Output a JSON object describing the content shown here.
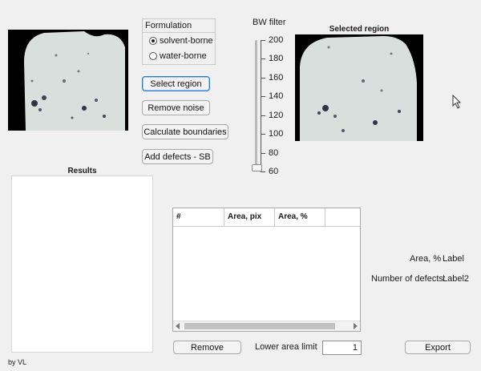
{
  "formulation": {
    "title": "Formulation",
    "options": [
      {
        "label": "solvent-borne",
        "selected": true
      },
      {
        "label": "water-borne",
        "selected": false
      }
    ]
  },
  "buttons": {
    "select_region": "Select region",
    "remove_noise": "Remove noise",
    "calculate_boundaries": "Calculate boundaries",
    "add_defects": "Add defects - SB",
    "remove": "Remove",
    "export": "Export"
  },
  "bw_filter": {
    "label": "BW filter",
    "ticks": [
      "200",
      "180",
      "160",
      "140",
      "120",
      "100",
      "80",
      "60"
    ],
    "min": 60,
    "max": 200,
    "value": 64
  },
  "selected_region": {
    "title": "Selected region"
  },
  "results": {
    "title": "Results"
  },
  "table": {
    "columns": [
      "#",
      "Area, pix",
      "Area, %"
    ]
  },
  "lower_area_limit": {
    "label": "Lower area limit",
    "value": "1"
  },
  "area_label": {
    "caption": "Area, %",
    "value": "Label"
  },
  "defects_label": {
    "caption": "Number of defects:",
    "value": "Label2"
  },
  "footer": {
    "credit": "by VL"
  },
  "colors": {
    "accent": "#2a7bd0",
    "sample": "#d7dedb",
    "image_bg": "#000000"
  }
}
